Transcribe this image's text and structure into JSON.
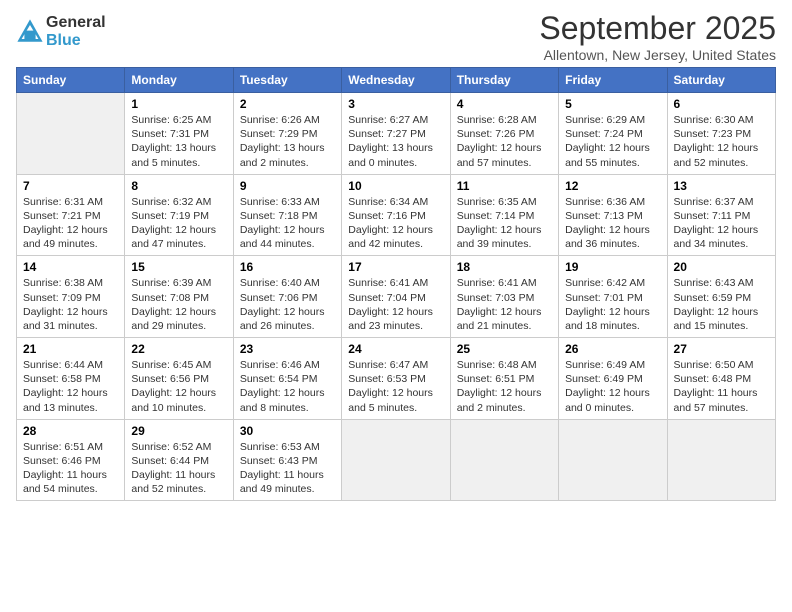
{
  "header": {
    "logo_line1": "General",
    "logo_line2": "Blue",
    "title": "September 2025",
    "subtitle": "Allentown, New Jersey, United States"
  },
  "days_of_week": [
    "Sunday",
    "Monday",
    "Tuesday",
    "Wednesday",
    "Thursday",
    "Friday",
    "Saturday"
  ],
  "weeks": [
    [
      {
        "date": "",
        "sunrise": "",
        "sunset": "",
        "daylight": "",
        "empty": true
      },
      {
        "date": "1",
        "sunrise": "Sunrise: 6:25 AM",
        "sunset": "Sunset: 7:31 PM",
        "daylight": "Daylight: 13 hours and 5 minutes."
      },
      {
        "date": "2",
        "sunrise": "Sunrise: 6:26 AM",
        "sunset": "Sunset: 7:29 PM",
        "daylight": "Daylight: 13 hours and 2 minutes."
      },
      {
        "date": "3",
        "sunrise": "Sunrise: 6:27 AM",
        "sunset": "Sunset: 7:27 PM",
        "daylight": "Daylight: 13 hours and 0 minutes."
      },
      {
        "date": "4",
        "sunrise": "Sunrise: 6:28 AM",
        "sunset": "Sunset: 7:26 PM",
        "daylight": "Daylight: 12 hours and 57 minutes."
      },
      {
        "date": "5",
        "sunrise": "Sunrise: 6:29 AM",
        "sunset": "Sunset: 7:24 PM",
        "daylight": "Daylight: 12 hours and 55 minutes."
      },
      {
        "date": "6",
        "sunrise": "Sunrise: 6:30 AM",
        "sunset": "Sunset: 7:23 PM",
        "daylight": "Daylight: 12 hours and 52 minutes."
      }
    ],
    [
      {
        "date": "7",
        "sunrise": "Sunrise: 6:31 AM",
        "sunset": "Sunset: 7:21 PM",
        "daylight": "Daylight: 12 hours and 49 minutes."
      },
      {
        "date": "8",
        "sunrise": "Sunrise: 6:32 AM",
        "sunset": "Sunset: 7:19 PM",
        "daylight": "Daylight: 12 hours and 47 minutes."
      },
      {
        "date": "9",
        "sunrise": "Sunrise: 6:33 AM",
        "sunset": "Sunset: 7:18 PM",
        "daylight": "Daylight: 12 hours and 44 minutes."
      },
      {
        "date": "10",
        "sunrise": "Sunrise: 6:34 AM",
        "sunset": "Sunset: 7:16 PM",
        "daylight": "Daylight: 12 hours and 42 minutes."
      },
      {
        "date": "11",
        "sunrise": "Sunrise: 6:35 AM",
        "sunset": "Sunset: 7:14 PM",
        "daylight": "Daylight: 12 hours and 39 minutes."
      },
      {
        "date": "12",
        "sunrise": "Sunrise: 6:36 AM",
        "sunset": "Sunset: 7:13 PM",
        "daylight": "Daylight: 12 hours and 36 minutes."
      },
      {
        "date": "13",
        "sunrise": "Sunrise: 6:37 AM",
        "sunset": "Sunset: 7:11 PM",
        "daylight": "Daylight: 12 hours and 34 minutes."
      }
    ],
    [
      {
        "date": "14",
        "sunrise": "Sunrise: 6:38 AM",
        "sunset": "Sunset: 7:09 PM",
        "daylight": "Daylight: 12 hours and 31 minutes."
      },
      {
        "date": "15",
        "sunrise": "Sunrise: 6:39 AM",
        "sunset": "Sunset: 7:08 PM",
        "daylight": "Daylight: 12 hours and 29 minutes."
      },
      {
        "date": "16",
        "sunrise": "Sunrise: 6:40 AM",
        "sunset": "Sunset: 7:06 PM",
        "daylight": "Daylight: 12 hours and 26 minutes."
      },
      {
        "date": "17",
        "sunrise": "Sunrise: 6:41 AM",
        "sunset": "Sunset: 7:04 PM",
        "daylight": "Daylight: 12 hours and 23 minutes."
      },
      {
        "date": "18",
        "sunrise": "Sunrise: 6:41 AM",
        "sunset": "Sunset: 7:03 PM",
        "daylight": "Daylight: 12 hours and 21 minutes."
      },
      {
        "date": "19",
        "sunrise": "Sunrise: 6:42 AM",
        "sunset": "Sunset: 7:01 PM",
        "daylight": "Daylight: 12 hours and 18 minutes."
      },
      {
        "date": "20",
        "sunrise": "Sunrise: 6:43 AM",
        "sunset": "Sunset: 6:59 PM",
        "daylight": "Daylight: 12 hours and 15 minutes."
      }
    ],
    [
      {
        "date": "21",
        "sunrise": "Sunrise: 6:44 AM",
        "sunset": "Sunset: 6:58 PM",
        "daylight": "Daylight: 12 hours and 13 minutes."
      },
      {
        "date": "22",
        "sunrise": "Sunrise: 6:45 AM",
        "sunset": "Sunset: 6:56 PM",
        "daylight": "Daylight: 12 hours and 10 minutes."
      },
      {
        "date": "23",
        "sunrise": "Sunrise: 6:46 AM",
        "sunset": "Sunset: 6:54 PM",
        "daylight": "Daylight: 12 hours and 8 minutes."
      },
      {
        "date": "24",
        "sunrise": "Sunrise: 6:47 AM",
        "sunset": "Sunset: 6:53 PM",
        "daylight": "Daylight: 12 hours and 5 minutes."
      },
      {
        "date": "25",
        "sunrise": "Sunrise: 6:48 AM",
        "sunset": "Sunset: 6:51 PM",
        "daylight": "Daylight: 12 hours and 2 minutes."
      },
      {
        "date": "26",
        "sunrise": "Sunrise: 6:49 AM",
        "sunset": "Sunset: 6:49 PM",
        "daylight": "Daylight: 12 hours and 0 minutes."
      },
      {
        "date": "27",
        "sunrise": "Sunrise: 6:50 AM",
        "sunset": "Sunset: 6:48 PM",
        "daylight": "Daylight: 11 hours and 57 minutes."
      }
    ],
    [
      {
        "date": "28",
        "sunrise": "Sunrise: 6:51 AM",
        "sunset": "Sunset: 6:46 PM",
        "daylight": "Daylight: 11 hours and 54 minutes."
      },
      {
        "date": "29",
        "sunrise": "Sunrise: 6:52 AM",
        "sunset": "Sunset: 6:44 PM",
        "daylight": "Daylight: 11 hours and 52 minutes."
      },
      {
        "date": "30",
        "sunrise": "Sunrise: 6:53 AM",
        "sunset": "Sunset: 6:43 PM",
        "daylight": "Daylight: 11 hours and 49 minutes."
      },
      {
        "date": "",
        "sunrise": "",
        "sunset": "",
        "daylight": "",
        "empty": true
      },
      {
        "date": "",
        "sunrise": "",
        "sunset": "",
        "daylight": "",
        "empty": true
      },
      {
        "date": "",
        "sunrise": "",
        "sunset": "",
        "daylight": "",
        "empty": true
      },
      {
        "date": "",
        "sunrise": "",
        "sunset": "",
        "daylight": "",
        "empty": true
      }
    ]
  ]
}
